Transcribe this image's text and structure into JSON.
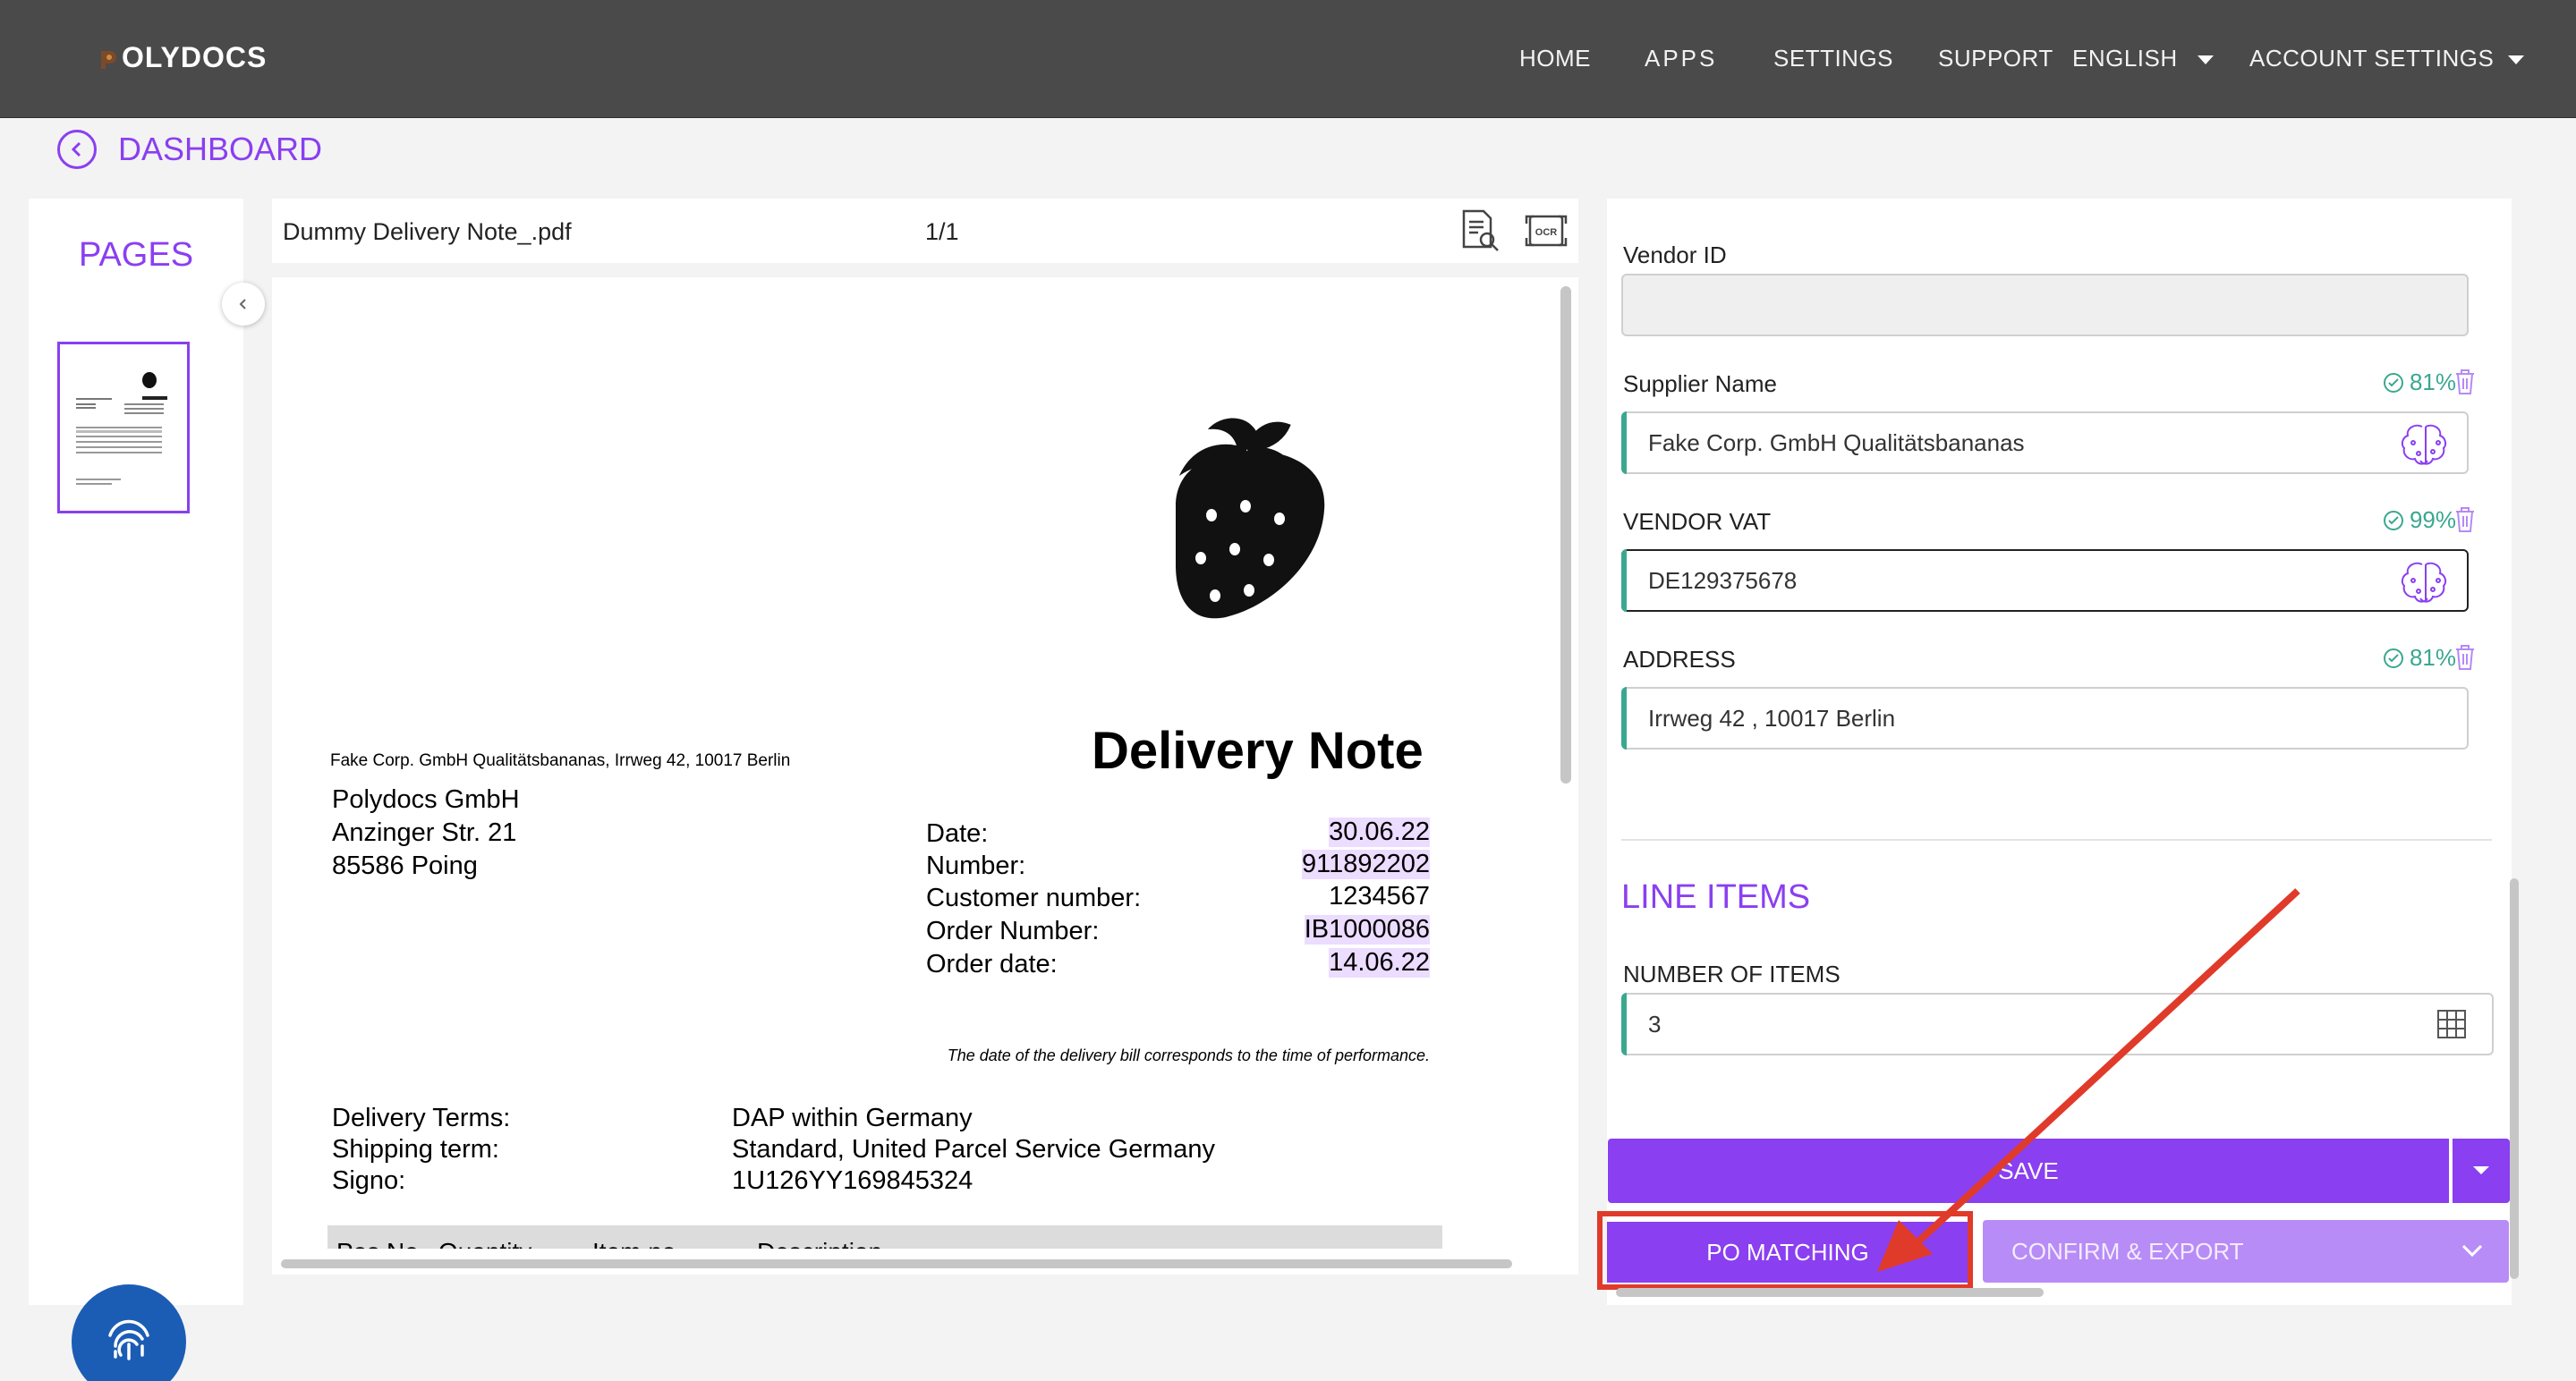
{
  "header": {
    "logo_text": "OLYDOCS",
    "nav": {
      "home": "HOME",
      "apps": "APPS",
      "settings": "SETTINGS",
      "support": "SUPPORT",
      "language": "ENGLISH",
      "account": "ACCOUNT SETTINGS"
    }
  },
  "breadcrumb": {
    "label": "DASHBOARD"
  },
  "pages_panel": {
    "title": "PAGES"
  },
  "document": {
    "file_name": "Dummy Delivery Note_.pdf",
    "page_indicator": "1/1",
    "sender_line": "Fake Corp. GmbH Qualitätsbananas, Irrweg 42, 10017 Berlin",
    "recipient": [
      "Polydocs GmbH",
      "Anzinger Str. 21",
      "85586 Poing"
    ],
    "title": "Delivery Note",
    "meta": [
      {
        "label": "Date:",
        "value": "30.06.22"
      },
      {
        "label": "Number:",
        "value": "911892202"
      },
      {
        "label": "Customer number:",
        "value": "1234567"
      },
      {
        "label": "Order Number:",
        "value": "IB1000086"
      },
      {
        "label": "Order date:",
        "value": "14.06.22"
      }
    ],
    "note": "The date of the delivery bill corresponds to the time of performance.",
    "terms": [
      {
        "label": "Delivery Terms:",
        "value": "DAP within Germany"
      },
      {
        "label": "Shipping term:",
        "value": "Standard, United Parcel Service Germany"
      },
      {
        "label": "Signo:",
        "value": "1U126YY169845324"
      }
    ],
    "table_headers": [
      "Pos No.",
      "Quantity",
      "Item no.",
      "Description"
    ]
  },
  "fields": {
    "vendor_id": {
      "label": "Vendor ID",
      "value": ""
    },
    "supplier_name": {
      "label": "Supplier Name",
      "value": "Fake Corp. GmbH Qualitätsbananas",
      "confidence": "81%"
    },
    "vendor_vat": {
      "label": "VENDOR VAT",
      "value": "DE129375678",
      "confidence": "99%"
    },
    "address": {
      "label": "ADDRESS",
      "value": "Irrweg 42 , 10017 Berlin",
      "confidence": "81%"
    },
    "line_items_title": "LINE ITEMS",
    "number_of_items": {
      "label": "NUMBER OF ITEMS",
      "value": "3"
    }
  },
  "actions": {
    "save": "SAVE",
    "po_matching": "PO MATCHING",
    "confirm_export": "CONFIRM & EXPORT"
  },
  "colors": {
    "accent": "#8a3ff0",
    "accent_light": "#b88cf6",
    "topbar": "#4a4a4a",
    "success": "#3aa890",
    "annotation": "#e03a2a",
    "fab": "#1b5db5"
  },
  "icons": [
    "back-circle-icon",
    "chevron-left-icon",
    "document-search-icon",
    "ocr-icon",
    "check-circle-icon",
    "trash-icon",
    "ai-brain-icon",
    "grid-icon",
    "chevron-down-icon",
    "fingerprint-icon",
    "strawberry-logo"
  ]
}
